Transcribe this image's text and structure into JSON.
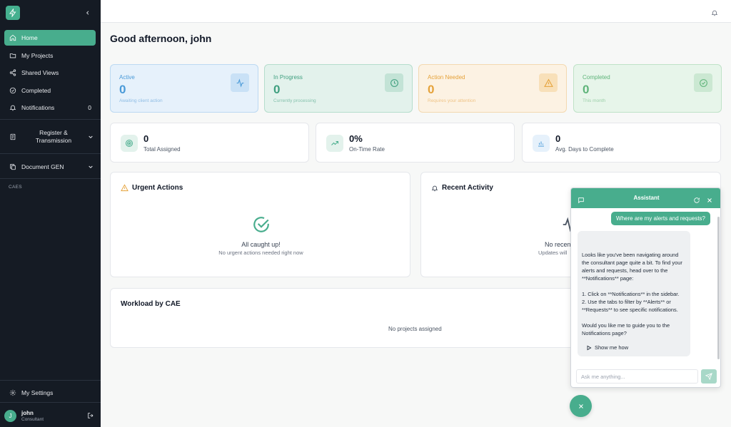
{
  "sidebar": {
    "items": [
      {
        "label": "Home",
        "icon": "home-icon"
      },
      {
        "label": "My Projects",
        "icon": "folder-icon"
      },
      {
        "label": "Shared Views",
        "icon": "share-icon"
      },
      {
        "label": "Completed",
        "icon": "check-circle-icon"
      },
      {
        "label": "Notifications",
        "icon": "bell-icon",
        "count": "0"
      }
    ],
    "groups": [
      {
        "label": "Register &\nTransmission",
        "icon": "document-icon"
      },
      {
        "label": "Document GEN",
        "icon": "copy-icon"
      }
    ],
    "section_label": "CAES",
    "settings_label": "My Settings",
    "user": {
      "initial": "J",
      "name": "john",
      "role": "Consultant"
    }
  },
  "greeting": "Good afternoon, john",
  "stats": [
    {
      "label": "Active",
      "value": "0",
      "sub": "Awaiting client action",
      "color": "#4a9ad8"
    },
    {
      "label": "In Progress",
      "value": "0",
      "sub": "Currently processing",
      "color": "#3f9f7f"
    },
    {
      "label": "Action Needed",
      "value": "0",
      "sub": "Requires your attention",
      "color": "#e5a23a"
    },
    {
      "label": "Completed",
      "value": "0",
      "sub": "This month",
      "color": "#5fb47a"
    }
  ],
  "metrics": [
    {
      "value": "0",
      "label": "Total Assigned"
    },
    {
      "value": "0%",
      "label": "On-Time Rate"
    },
    {
      "value": "0",
      "label": "Avg. Days to Complete"
    }
  ],
  "urgent": {
    "title": "Urgent Actions",
    "empty_title": "All caught up!",
    "empty_sub": "No urgent actions needed right now"
  },
  "recent": {
    "title": "Recent Activity",
    "empty_title": "No recen",
    "empty_sub": "Updates will"
  },
  "workload": {
    "title": "Workload by CAE",
    "empty": "No projects assigned"
  },
  "chat": {
    "title": "Assistant",
    "user_message": "Where are my alerts and requests?",
    "bot_message": "Looks like you've been navigating around the consultant page quite a bit. To find your alerts and requests, head over to the **Notifications** page:\n\n1. Click on **Notifications** in the sidebar.\n2. Use the tabs to filter by **Alerts** or **Requests** to see specific notifications.\n\nWould you like me to guide you to the Notifications page?",
    "show_me_label": "Show me how",
    "input_placeholder": "Ask me anything..."
  },
  "colors": {
    "accent": "#48ad8d",
    "sidebar_bg": "#151b24"
  }
}
